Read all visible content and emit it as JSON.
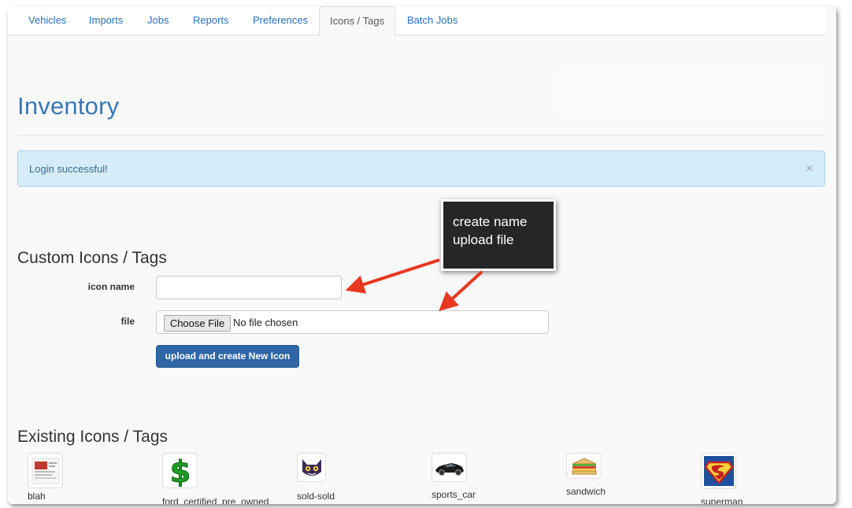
{
  "tabs": [
    {
      "label": "Vehicles"
    },
    {
      "label": "Imports"
    },
    {
      "label": "Jobs"
    },
    {
      "label": "Reports"
    },
    {
      "label": "Preferences"
    },
    {
      "label": "Icons / Tags",
      "active": true
    },
    {
      "label": "Batch Jobs"
    }
  ],
  "page": {
    "title": "Inventory"
  },
  "alert": {
    "message": "Login successful!",
    "close_glyph": "×"
  },
  "custom": {
    "heading": "Custom Icons / Tags",
    "icon_name_label": "icon name",
    "icon_name_value": "",
    "file_label": "file",
    "choose_file_label": "Choose File",
    "no_file_text": "No file chosen",
    "submit_label": "upload and create New Icon"
  },
  "callout": {
    "line1": "create name",
    "line2": "upload file"
  },
  "existing": {
    "heading": "Existing Icons / Tags",
    "icons": [
      {
        "name": "blah",
        "icon": "screenshot-thumbnail-icon"
      },
      {
        "name": "ford_certified_pre_owned",
        "icon": "dollar-sign-icon"
      },
      {
        "name": "sold-sold",
        "icon": "cat-face-icon"
      },
      {
        "name": "sports_car",
        "icon": "sports-car-icon"
      },
      {
        "name": "sandwich",
        "icon": "sandwich-icon"
      },
      {
        "name": "superman",
        "icon": "superman-logo-icon"
      }
    ]
  },
  "colors": {
    "link": "#2a6ebb",
    "title": "#3a78b6",
    "alert_bg": "#d6ecf8",
    "button": "#2f66a6",
    "annotation_arrow": "#e8381f"
  }
}
